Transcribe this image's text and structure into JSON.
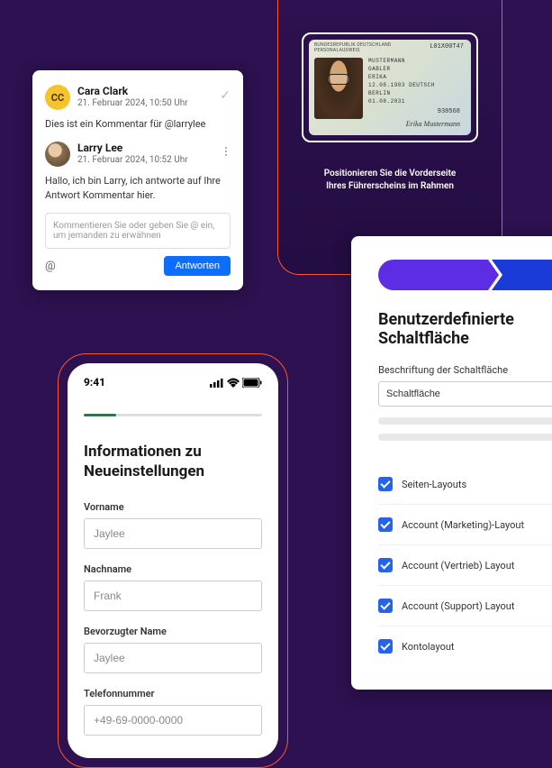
{
  "comments": {
    "first": {
      "initials": "CC",
      "name": "Cara Clark",
      "date": "21. Februar 2024, 10:50 Uhr",
      "body": "Dies ist ein Kommentar für @larrylee"
    },
    "second": {
      "name": "Larry Lee",
      "date": "21. Februar 2024, 10:52 Uhr",
      "body": "Hallo, ich bin Larry, ich antworte auf Ihre Antwort Kommentar hier."
    },
    "input_placeholder": "Kommentieren Sie oder geben Sie @ ein, um jemanden zu erwähnen",
    "mention_symbol": "@",
    "reply_label": "Antworten"
  },
  "id_card": {
    "header_line1": "BUNDESREPUBLIK DEUTSCHLAND",
    "header_line2": "PERSONALAUSWEIS",
    "number": "L01X00T47",
    "surname": "MUSTERMANN",
    "maiden": "GABLER",
    "given": "ERIKA",
    "dob": "12.08.1983 DEUTSCH",
    "place": "BERLIN",
    "expiry": "01.08.2031",
    "code": "938568",
    "instruction_line1": "Positionieren Sie die Vorderseite",
    "instruction_line2": "Ihres Führerscheins im Rahmen"
  },
  "form": {
    "title": "Benutzerdefinierte Schaltfläche",
    "label": "Beschriftung der Schaltfläche",
    "input_value": "Schaltfläche",
    "items": [
      "Seiten-Layouts",
      "Account (Marketing)-Layout",
      "Account (Vertrieb) Layout",
      "Account (Support) Layout",
      "Kontolayout"
    ]
  },
  "phone": {
    "time": "9:41",
    "title": "Informationen zu Neueinstellungen",
    "fields": {
      "vorname_label": "Vorname",
      "vorname_value": "Jaylee",
      "nachname_label": "Nachname",
      "nachname_value": "Frank",
      "pref_label": "Bevorzugter Name",
      "pref_value": "Jaylee",
      "tel_label": "Telefonnummer",
      "tel_value": "+49-69-0000-0000"
    }
  }
}
